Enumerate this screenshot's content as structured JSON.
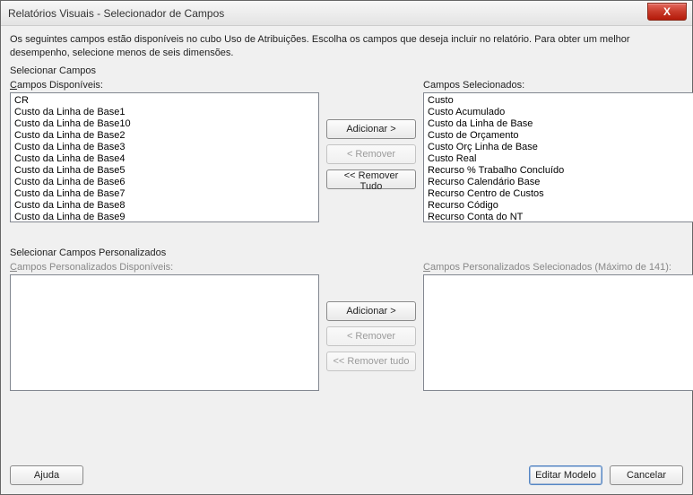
{
  "window": {
    "title": "Relatórios Visuais - Selecionador de Campos",
    "close_glyph": "X"
  },
  "instruction": "Os seguintes campos estão disponíveis no cubo Uso de Atribuições. Escolha os campos que deseja incluir no relatório. Para obter um melhor desempenho, selecione menos de seis dimensões.",
  "section1": {
    "title": "Selecionar Campos",
    "available_label_pre": "C",
    "available_label_rest": "ampos Disponíveis:",
    "selected_label_pre": "C",
    "selected_label_rest": "ampos Selecionados:",
    "available_items": [
      "CR",
      "Custo da Linha de Base1",
      "Custo da Linha de Base10",
      "Custo da Linha de Base2",
      "Custo da Linha de Base3",
      "Custo da Linha de Base4",
      "Custo da Linha de Base5",
      "Custo da Linha de Base6",
      "Custo da Linha de Base7",
      "Custo da Linha de Base8",
      "Custo da Linha de Base9"
    ],
    "selected_items": [
      "Custo",
      "Custo Acumulado",
      "Custo da Linha de Base",
      "Custo de Orçamento",
      "Custo Orç Linha de Base",
      "Custo Real",
      "Recurso % Trabalho Concluído",
      "Recurso Calendário Base",
      "Recurso Centro de Custos",
      "Recurso Código",
      "Recurso Conta do NT"
    ],
    "btn_add": "Adicionar >",
    "btn_remove": "< Remover",
    "btn_remove_all": "<< Remover Tudo"
  },
  "section2": {
    "title": "Selecionar Campos Personalizados",
    "available_label_pre": "C",
    "available_label_rest": "ampos Personalizados Disponíveis:",
    "selected_label_pre": "C",
    "selected_label_rest": "ampos Personalizados Selecionados (Máximo de 141):",
    "available_items": [],
    "selected_items": [],
    "btn_add": "Adicionar >",
    "btn_remove": "< Remover",
    "btn_remove_all": "<< Remover tudo"
  },
  "footer": {
    "help": "Ajuda",
    "edit_template": "Editar Modelo",
    "cancel": "Cancelar"
  }
}
